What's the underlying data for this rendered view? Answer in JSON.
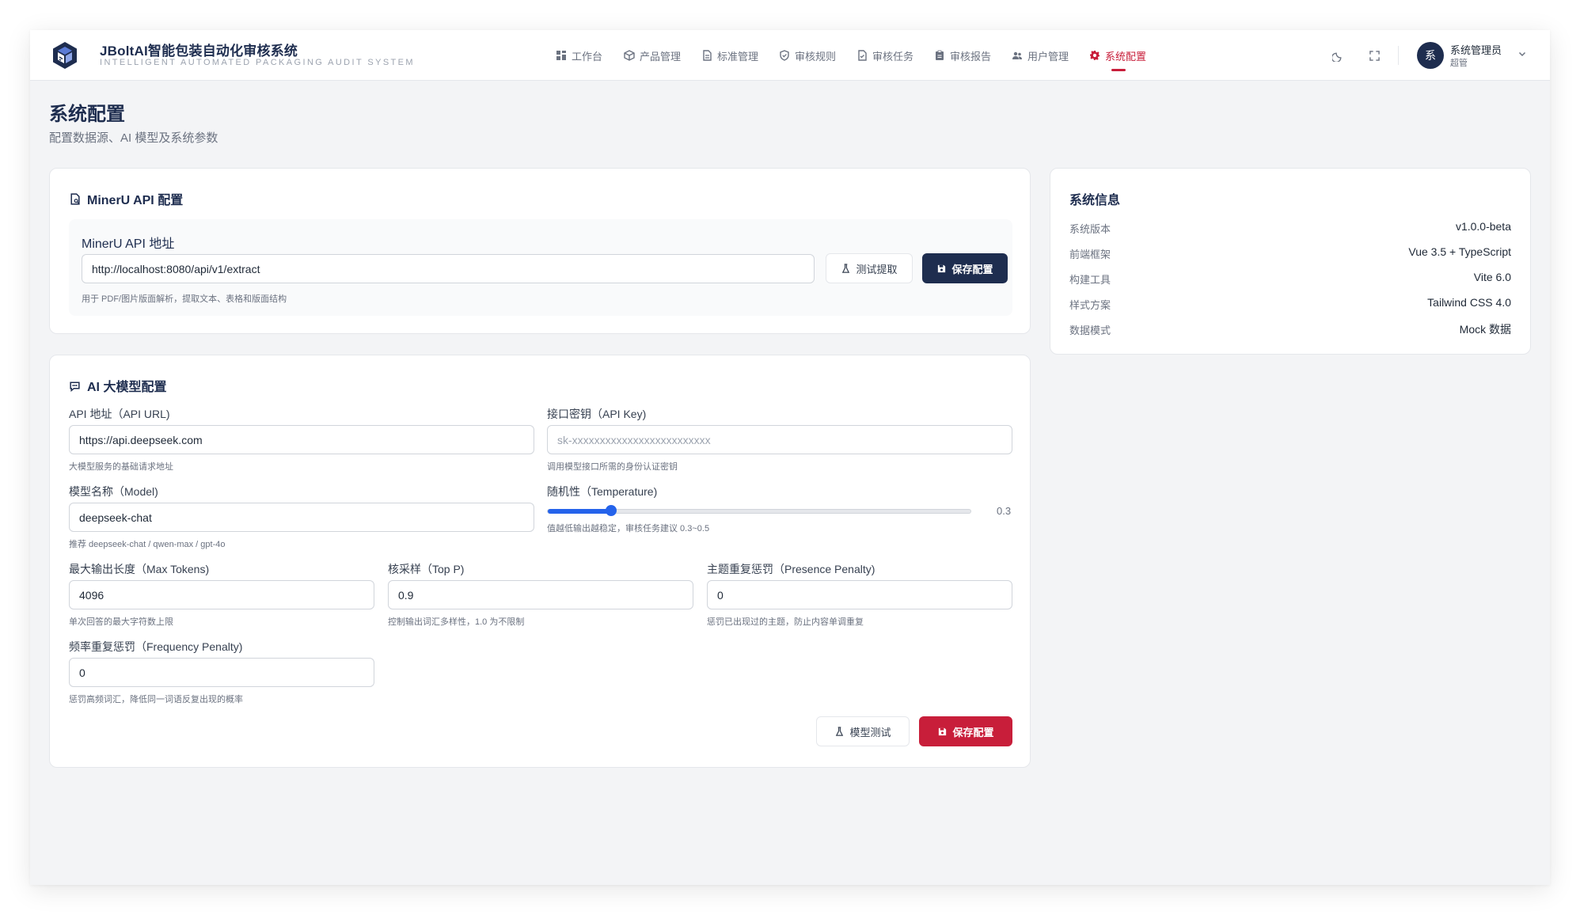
{
  "app": {
    "title": "JBoltAI智能包装自动化审核系统",
    "subtitle": "INTELLIGENT AUTOMATED PACKAGING AUDIT SYSTEM"
  },
  "nav": {
    "items": [
      {
        "label": "工作台",
        "icon": "dashboard-icon"
      },
      {
        "label": "产品管理",
        "icon": "cube-icon"
      },
      {
        "label": "标准管理",
        "icon": "document-icon"
      },
      {
        "label": "审核规则",
        "icon": "shield-icon"
      },
      {
        "label": "审核任务",
        "icon": "task-icon"
      },
      {
        "label": "审核报告",
        "icon": "clipboard-icon"
      },
      {
        "label": "用户管理",
        "icon": "users-icon"
      },
      {
        "label": "系统配置",
        "icon": "gear-icon",
        "active": true
      }
    ]
  },
  "user": {
    "avatar_text": "系",
    "name": "系统管理员",
    "role": "超管"
  },
  "page": {
    "title": "系统配置",
    "subtitle": "配置数据源、AI 模型及系统参数"
  },
  "mineru": {
    "title": "MinerU API 配置",
    "field_label": "MinerU API 地址",
    "url_value": "http://localhost:8080/api/v1/extract",
    "hint": "用于 PDF/图片版面解析，提取文本、表格和版面结构",
    "test_button": "测试提取",
    "save_button": "保存配置"
  },
  "ai": {
    "title": "AI 大模型配置",
    "api_url": {
      "label": "API 地址（API URL)",
      "value": "https://api.deepseek.com",
      "hint": "大模型服务的基础请求地址"
    },
    "api_key": {
      "label": "接口密钥（API Key)",
      "placeholder": "sk-xxxxxxxxxxxxxxxxxxxxxxxxx",
      "hint": "调用模型接口所需的身份认证密钥"
    },
    "model": {
      "label": "模型名称（Model)",
      "value": "deepseek-chat",
      "hint": "推荐 deepseek-chat / qwen-max / gpt-4o"
    },
    "temperature": {
      "label": "随机性（Temperature)",
      "value": "0.3",
      "fraction": 0.15,
      "hint": "值越低输出越稳定，审核任务建议 0.3~0.5"
    },
    "max_tokens": {
      "label": "最大输出长度（Max Tokens)",
      "value": "4096",
      "hint": "单次回答的最大字符数上限"
    },
    "top_p": {
      "label": "核采样（Top P)",
      "value": "0.9",
      "hint": "控制输出词汇多样性，1.0 为不限制"
    },
    "presence_penalty": {
      "label": "主题重复惩罚（Presence Penalty)",
      "value": "0",
      "hint": "惩罚已出现过的主题，防止内容单调重复"
    },
    "frequency_penalty": {
      "label": "频率重复惩罚（Frequency Penalty)",
      "value": "0",
      "hint": "惩罚高频词汇，降低同一词语反复出现的概率"
    },
    "test_button": "模型测试",
    "save_button": "保存配置"
  },
  "sysinfo": {
    "title": "系统信息",
    "rows": [
      {
        "label": "系统版本",
        "value": "v1.0.0-beta"
      },
      {
        "label": "前端框架",
        "value": "Vue 3.5 + TypeScript"
      },
      {
        "label": "构建工具",
        "value": "Vite 6.0"
      },
      {
        "label": "样式方案",
        "value": "Tailwind CSS 4.0"
      },
      {
        "label": "数据模式",
        "value": "Mock 数据"
      }
    ]
  },
  "colors": {
    "brand_navy": "#1e2d4f",
    "accent_red": "#c81e3a",
    "slider_blue": "#2563eb"
  }
}
